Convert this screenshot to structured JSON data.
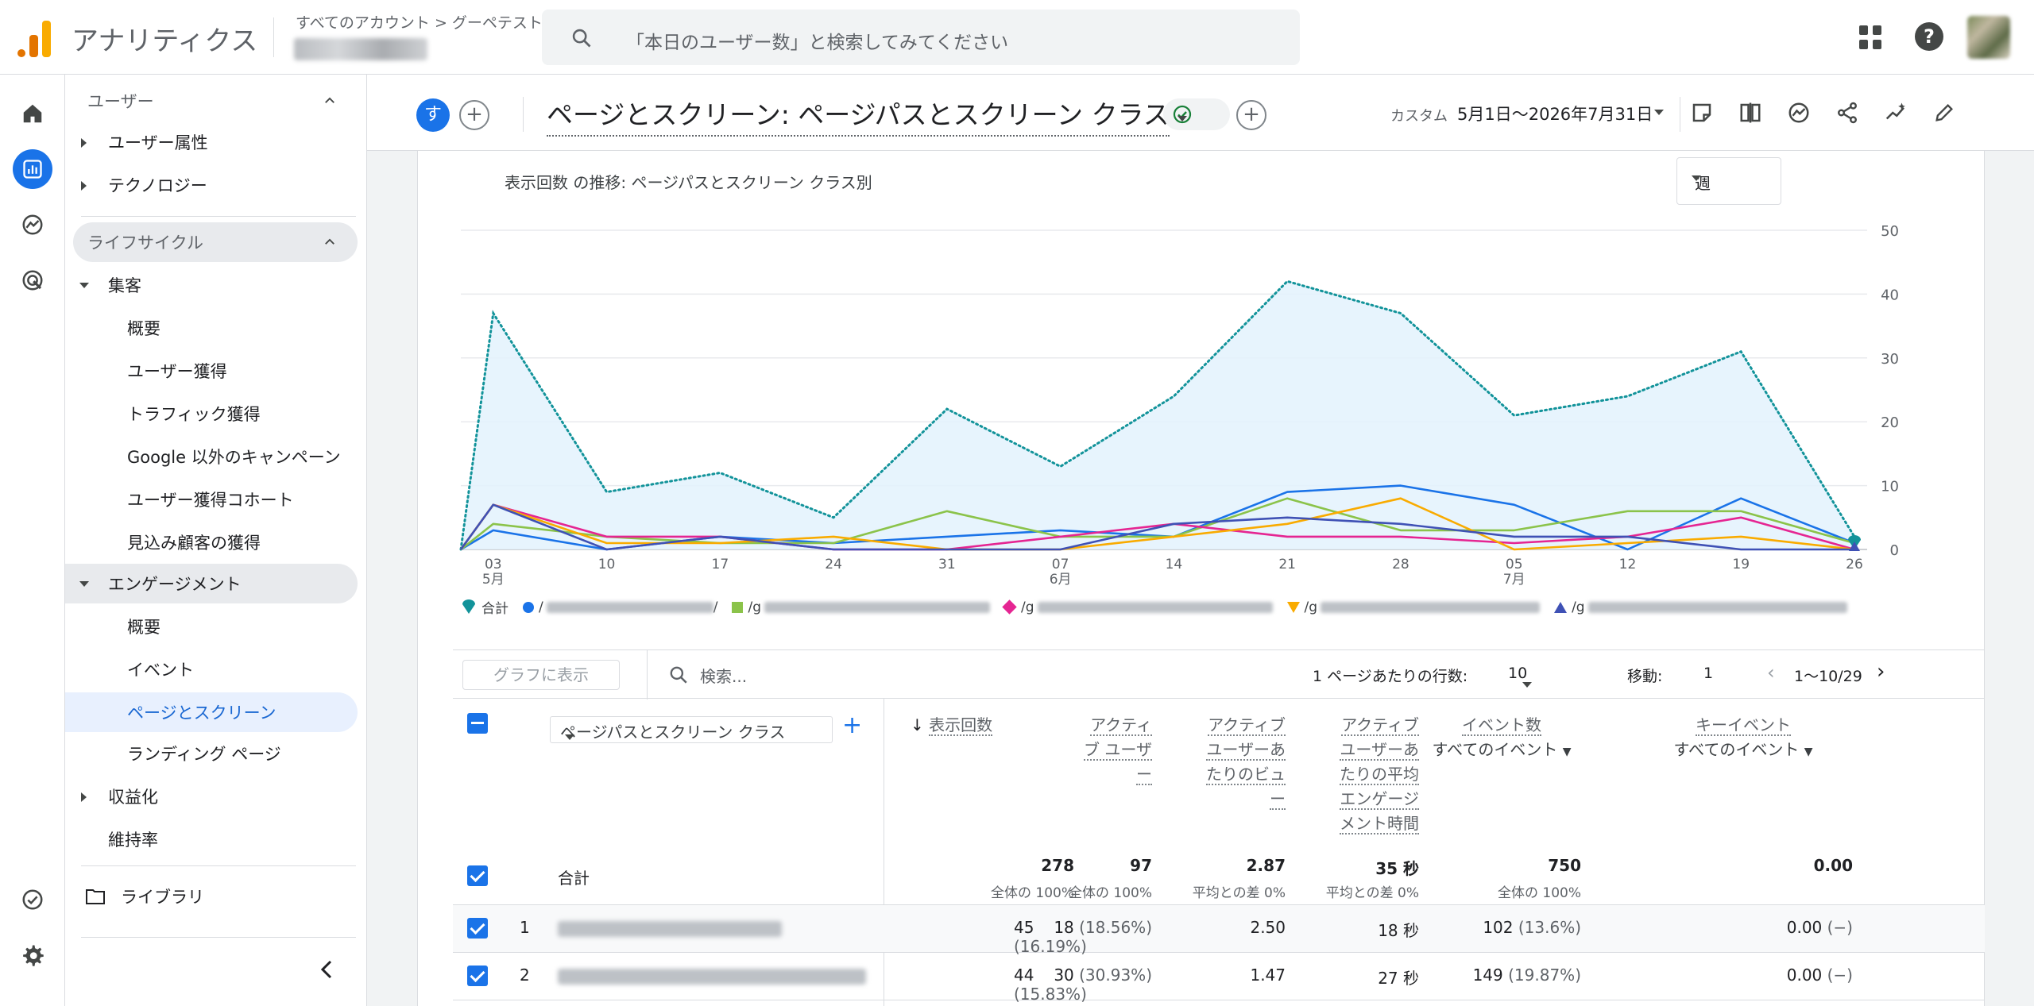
{
  "header": {
    "app_title": "アナリティクス",
    "breadcrumb": "すべてのアカウント > グーペテスト",
    "search_placeholder": "「本日のユーザー数」と検索してみてください"
  },
  "sidebar": {
    "user_section": "ユーザー",
    "user_items": [
      "ユーザー属性",
      "テクノロジー"
    ],
    "lifecycle_section": "ライフサイクル",
    "acquisition": "集客",
    "acquisition_items": [
      "概要",
      "ユーザー獲得",
      "トラフィック獲得",
      "Google 以外のキャンペーン",
      "ユーザー獲得コホート",
      "見込み顧客の獲得"
    ],
    "engagement": "エンゲージメント",
    "engagement_items": [
      "概要",
      "イベント",
      "ページとスクリーン",
      "ランディング ページ"
    ],
    "monetization": "収益化",
    "retention": "維持率",
    "library": "ライブラリ"
  },
  "toolbar": {
    "segment_initial": "す",
    "page_title": "ページとスクリーン: ページパスとスクリーン クラス",
    "date_label": "カスタム",
    "date_range": "5月1日～2026年7月31日"
  },
  "chart": {
    "heading": "表示回数 の推移: ページパスとスクリーン クラス別",
    "interval": "週",
    "legend_total": "合計",
    "legend_slash": "/",
    "legend_g": "/g"
  },
  "chart_data": {
    "type": "line",
    "x": [
      "5/1",
      "5/3",
      "5/10",
      "5/17",
      "5/24",
      "5/31",
      "6/7",
      "6/14",
      "6/21",
      "6/28",
      "7/5",
      "7/12",
      "7/19",
      "7/26",
      "7/31"
    ],
    "x_tick_labels": [
      {
        "day": "03",
        "month": "5月"
      },
      {
        "day": "10",
        "month": ""
      },
      {
        "day": "17",
        "month": ""
      },
      {
        "day": "24",
        "month": ""
      },
      {
        "day": "31",
        "month": ""
      },
      {
        "day": "07",
        "month": "6月"
      },
      {
        "day": "14",
        "month": ""
      },
      {
        "day": "21",
        "month": ""
      },
      {
        "day": "28",
        "month": ""
      },
      {
        "day": "05",
        "month": "7月"
      },
      {
        "day": "12",
        "month": ""
      },
      {
        "day": "19",
        "month": ""
      },
      {
        "day": "26",
        "month": ""
      }
    ],
    "y_ticks": [
      0,
      10,
      20,
      30,
      40,
      50
    ],
    "ylim": [
      0,
      50
    ],
    "series": [
      {
        "name": "合計",
        "color": "#12939a",
        "values": [
          0,
          37,
          9,
          12,
          5,
          22,
          13,
          24,
          42,
          37,
          21,
          24,
          31,
          2
        ]
      },
      {
        "color": "#1a73e8",
        "values": [
          0,
          3,
          0,
          2,
          1,
          2,
          3,
          2,
          9,
          10,
          7,
          0,
          8,
          1
        ]
      },
      {
        "color": "#8bc34a",
        "values": [
          0,
          4,
          2,
          1,
          1,
          6,
          2,
          2,
          8,
          3,
          3,
          6,
          6,
          1
        ]
      },
      {
        "color": "#e52592",
        "values": [
          0,
          7,
          2,
          2,
          0,
          0,
          2,
          4,
          2,
          2,
          1,
          2,
          5,
          0
        ]
      },
      {
        "color": "#f9ab00",
        "values": [
          0,
          7,
          1,
          1,
          2,
          0,
          0,
          2,
          4,
          8,
          0,
          1,
          2,
          0
        ]
      },
      {
        "color": "#3f51b5",
        "values": [
          0,
          7,
          0,
          2,
          0,
          0,
          0,
          4,
          5,
          4,
          2,
          2,
          0,
          0
        ]
      }
    ]
  },
  "table_controls": {
    "show_in_graph": "グラフに表示",
    "search_placeholder": "検索...",
    "rows_per_page_label": "1 ページあたりの行数:",
    "rows_per_page": "10",
    "move_label": "移動:",
    "move_value": "1",
    "page_range": "1～10/29"
  },
  "table": {
    "dimension": "ページパスとスクリーン クラス",
    "headers": {
      "views": "表示回数",
      "active_users": [
        "アクティ",
        "ブ ユーザ",
        "ー"
      ],
      "views_per_user": [
        "アクティブ",
        "ユーザーあ",
        "たりのビュ",
        "ー"
      ],
      "avg_engagement": [
        "アクティブ",
        "ユーザーあ",
        "たりの平均",
        "エンゲージ",
        "メント時間"
      ],
      "event_count": "イベント数",
      "key_events": "キーイベント",
      "all_events": "すべてのイベント"
    },
    "total": {
      "label": "合計",
      "views": "278",
      "views_sub": "全体の 100%",
      "active_users": "97",
      "active_users_sub": "全体の 100%",
      "views_per_user": "2.87",
      "views_per_user_sub": "平均との差 0%",
      "avg_engagement": "35 秒",
      "avg_engagement_sub": "平均との差 0%",
      "event_count": "750",
      "event_count_sub": "全体の 100%",
      "key_events": "0.00"
    },
    "rows": [
      {
        "num": "1",
        "views": "45",
        "views_pct": "(16.19%)",
        "users": "18",
        "users_pct": "(18.56%)",
        "vpu": "2.50",
        "eng": "18 秒",
        "events": "102",
        "events_pct": "(13.6%)",
        "key": "0.00",
        "key_pct": "(−)"
      },
      {
        "num": "2",
        "views": "44",
        "views_pct": "(15.83%)",
        "users": "30",
        "users_pct": "(30.93%)",
        "vpu": "1.47",
        "eng": "27 秒",
        "events": "149",
        "events_pct": "(19.87%)",
        "key": "0.00",
        "key_pct": "(−)"
      }
    ]
  }
}
